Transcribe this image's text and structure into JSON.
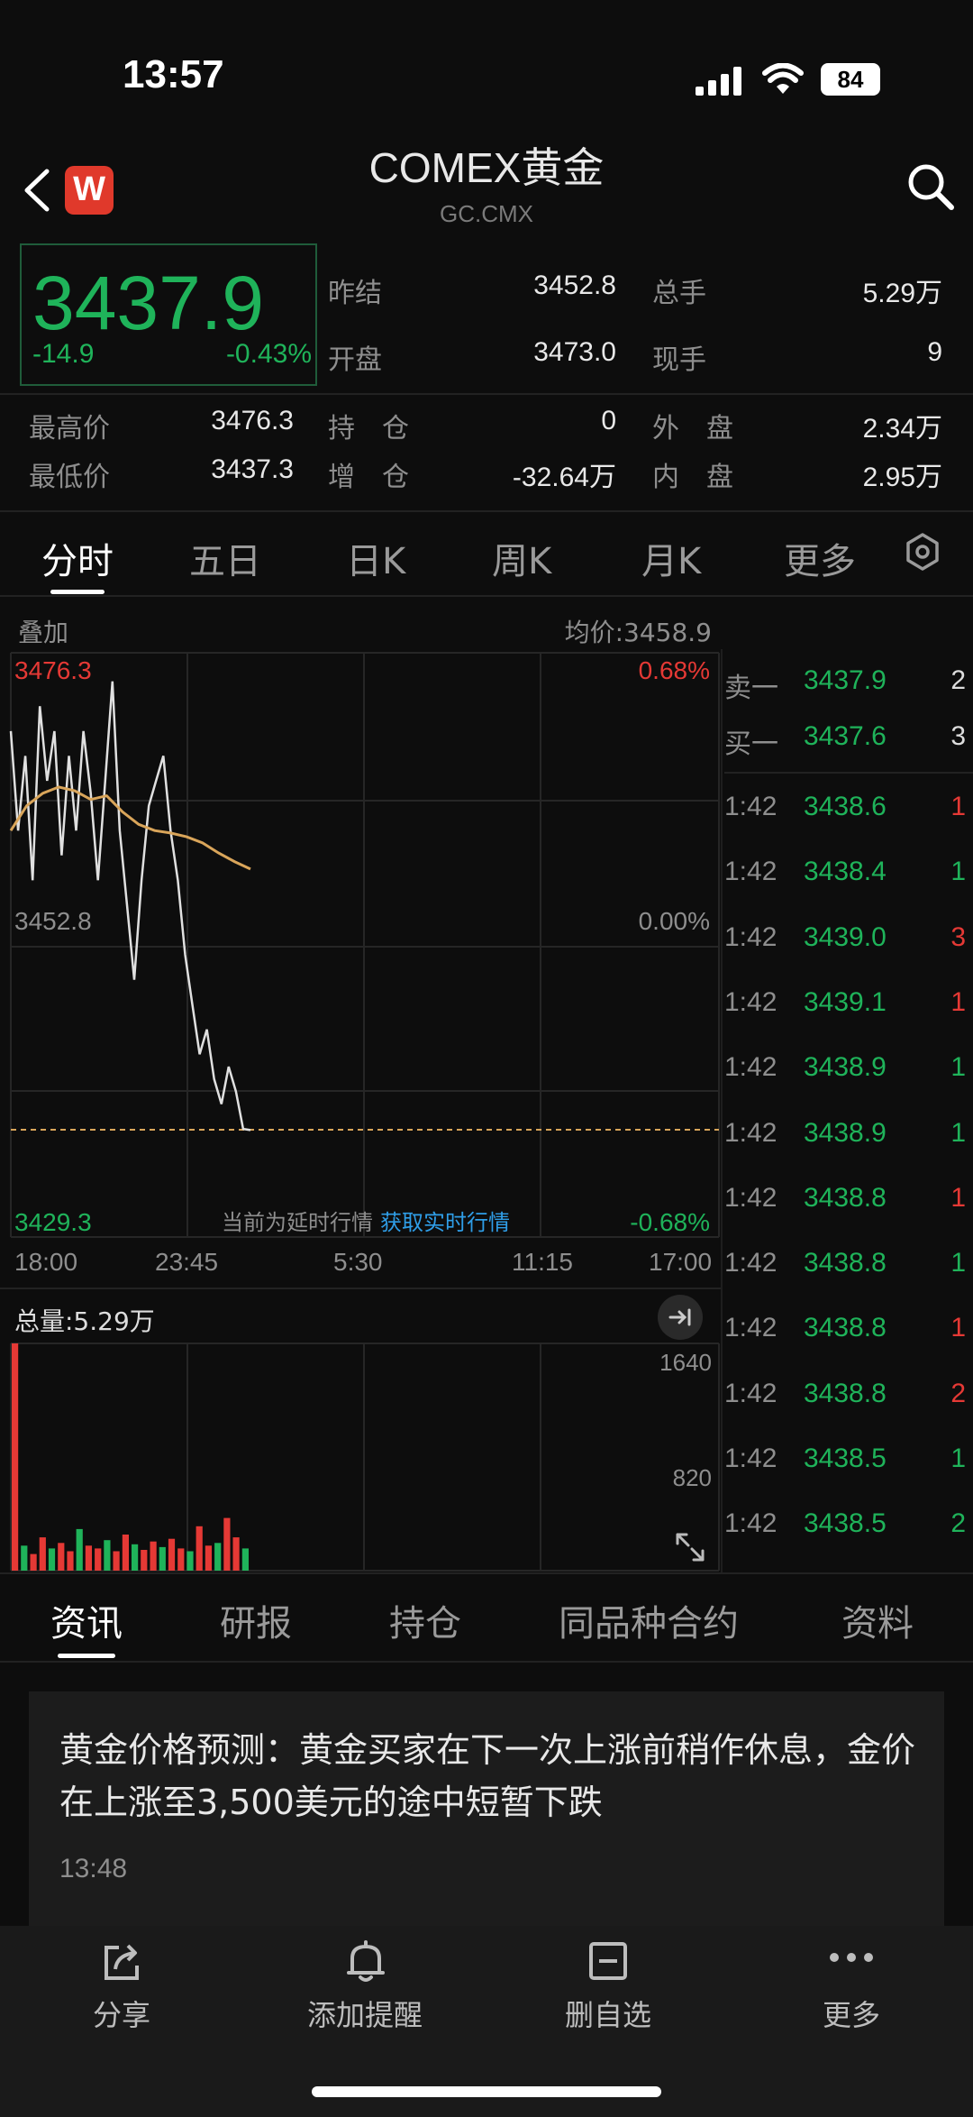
{
  "status": {
    "time": "13:57",
    "battery": "84"
  },
  "header": {
    "title": "COMEX黄金",
    "code": "GC.CMX",
    "logo": "W"
  },
  "quote": {
    "price": "3437.9",
    "change": "-14.9",
    "change_pct": "-0.43%",
    "prev_settle_label": "昨结",
    "prev_settle": "3452.8",
    "total_vol_label": "总手",
    "total_vol": "5.29万",
    "open_label": "开盘",
    "open": "3473.0",
    "cur_vol_label": "现手",
    "cur_vol": "9",
    "high_label": "最高价",
    "high": "3476.3",
    "low_label": "最低价",
    "low": "3437.3",
    "oi_label": "持　仓",
    "oi": "0",
    "oi_chg_label": "增　仓",
    "oi_chg": "-32.64万",
    "outer_label": "外　盘",
    "outer": "2.34万",
    "inner_label": "内　盘",
    "inner": "2.95万"
  },
  "chart_tabs": [
    "分时",
    "五日",
    "日K",
    "周K",
    "月K",
    "更多"
  ],
  "chart": {
    "overlay_label": "叠加",
    "avg_label": "均价:3458.9",
    "y_top": "3476.3",
    "y_mid": "3452.8",
    "y_bot": "3429.3",
    "pct_top": "0.68%",
    "pct_mid": "0.00%",
    "pct_bot": "-0.68%",
    "delay_notice": "当前为延时行情",
    "realtime_link": "获取实时行情",
    "x_labels": [
      "18:00",
      "23:45",
      "5:30",
      "11:15",
      "17:00"
    ],
    "vol_label": "总量:5.29万",
    "vol_top": "1640",
    "vol_mid": "820"
  },
  "chart_data": {
    "type": "line",
    "ylim": [
      3429.3,
      3476.3
    ],
    "series": [
      {
        "values": [
          3470,
          3462,
          3468,
          3458,
          3472,
          3466,
          3470,
          3460,
          3468,
          3462,
          3470,
          3465,
          3458,
          3466,
          3474,
          3462,
          3456,
          3450,
          3458,
          3464,
          3466,
          3468,
          3462,
          3458,
          3452,
          3448,
          3444,
          3446,
          3442,
          3440,
          3443,
          3441,
          3438,
          3437.9
        ]
      },
      {
        "values": [
          3462,
          3464,
          3465,
          3465.5,
          3465.2,
          3464.5,
          3464.8,
          3463.5,
          3462.5,
          3462,
          3461.8,
          3461.5,
          3461,
          3460.2,
          3459.5,
          3458.9
        ]
      }
    ],
    "volume": [
      1640,
      180,
      120,
      240,
      160,
      200,
      140,
      300,
      180,
      160,
      220,
      140,
      260,
      190,
      150,
      210,
      170,
      230,
      160,
      140,
      320,
      180,
      200,
      380,
      240,
      160
    ]
  },
  "order_book": {
    "ask_label": "卖一",
    "ask_price": "3437.9",
    "ask_qty": "2",
    "bid_label": "买一",
    "bid_price": "3437.6",
    "bid_qty": "3",
    "trades": [
      {
        "time": "1:42",
        "price": "3438.6",
        "qty": "1",
        "color": "#e53935"
      },
      {
        "time": "1:42",
        "price": "3438.4",
        "qty": "1",
        "color": "#1fb35a"
      },
      {
        "time": "1:42",
        "price": "3439.0",
        "qty": "3",
        "color": "#e53935"
      },
      {
        "time": "1:42",
        "price": "3439.1",
        "qty": "1",
        "color": "#e53935"
      },
      {
        "time": "1:42",
        "price": "3438.9",
        "qty": "1",
        "color": "#1fb35a"
      },
      {
        "time": "1:42",
        "price": "3438.9",
        "qty": "1",
        "color": "#1fb35a"
      },
      {
        "time": "1:42",
        "price": "3438.8",
        "qty": "1",
        "color": "#e53935"
      },
      {
        "time": "1:42",
        "price": "3438.8",
        "qty": "1",
        "color": "#1fb35a"
      },
      {
        "time": "1:42",
        "price": "3438.8",
        "qty": "1",
        "color": "#e53935"
      },
      {
        "time": "1:42",
        "price": "3438.8",
        "qty": "2",
        "color": "#e53935"
      },
      {
        "time": "1:42",
        "price": "3438.5",
        "qty": "1",
        "color": "#1fb35a"
      },
      {
        "time": "1:42",
        "price": "3438.5",
        "qty": "2",
        "color": "#1fb35a"
      }
    ]
  },
  "info_tabs": [
    "资讯",
    "研报",
    "持仓",
    "同品种合约",
    "资料"
  ],
  "news": {
    "headline": "黄金价格预测：黄金买家在下一次上涨前稍作休息，金价在上涨至3,500美元的途中短暂下跌",
    "time": "13:48"
  },
  "bottom_bar": [
    "分享",
    "添加提醒",
    "删自选",
    "更多"
  ],
  "colors": {
    "up": "#e53935",
    "down": "#1fb35a",
    "avg_line": "#d9a55a",
    "price_line": "#e0e0e0"
  }
}
